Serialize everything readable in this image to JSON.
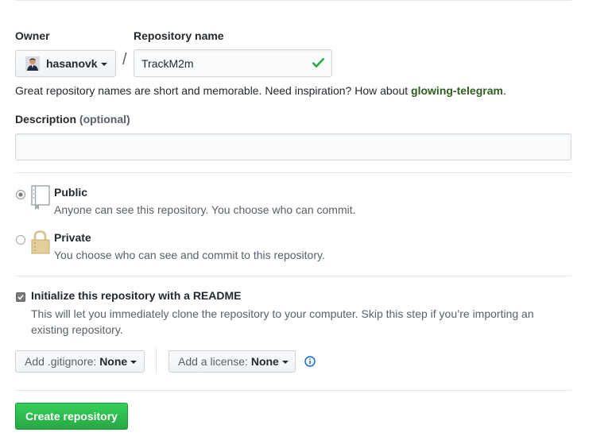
{
  "owner": {
    "label": "Owner",
    "value": "hasanovk"
  },
  "separator": "/",
  "repo_name": {
    "label": "Repository name",
    "value": "TrackM2m"
  },
  "name_hint": {
    "prefix": "Great repository names are short and memorable. Need inspiration? How about ",
    "suggestion": "glowing-telegram",
    "suffix": "."
  },
  "description": {
    "label": "Description",
    "optional": "(optional)",
    "value": ""
  },
  "visibility": {
    "public": {
      "title": "Public",
      "desc": "Anyone can see this repository. You choose who can commit.",
      "selected": true
    },
    "private": {
      "title": "Private",
      "desc": "You choose who can see and commit to this repository.",
      "selected": false
    }
  },
  "readme": {
    "title": "Initialize this repository with a README",
    "desc_line1": "This will let you immediately clone the repository to your computer. Skip this step if you’re importing an",
    "desc_line2": "existing repository.",
    "checked": true
  },
  "gitignore": {
    "prefix": "Add .gitignore:",
    "value": "None"
  },
  "license": {
    "prefix": "Add a license:",
    "value": "None"
  },
  "info_icon": "info-icon",
  "create_button": "Create repository",
  "colors": {
    "accent_green": "#28a745",
    "link_green": "#2c5e1f",
    "check_green": "#28a745",
    "info_blue": "#0366d6"
  }
}
